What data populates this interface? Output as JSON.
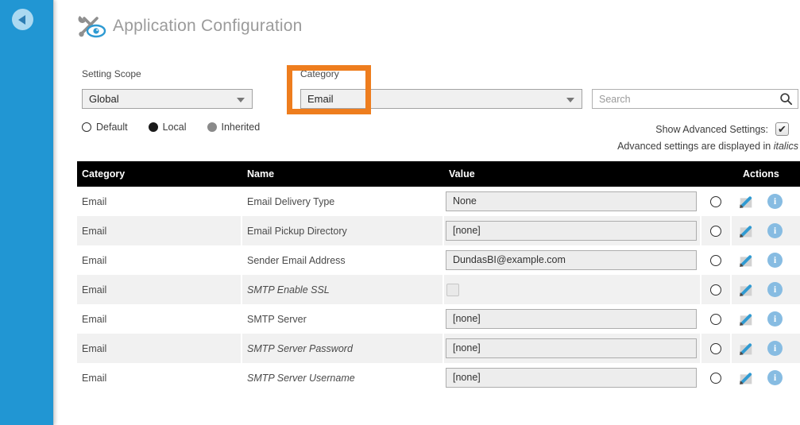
{
  "sidebar": {
    "back_tooltip": "Back"
  },
  "header": {
    "title": "Application Configuration"
  },
  "filters": {
    "setting_scope": {
      "label": "Setting Scope",
      "value": "Global"
    },
    "category": {
      "label": "Category",
      "value": "Email"
    },
    "search": {
      "placeholder": "Search"
    },
    "scope_options": [
      {
        "label": "Default",
        "state": "unchecked"
      },
      {
        "label": "Local",
        "state": "selected-black"
      },
      {
        "label": "Inherited",
        "state": "selected-gray"
      }
    ],
    "advanced_toggle": {
      "label": "Show Advanced Settings:",
      "checked": true,
      "checkmark": "✔"
    },
    "advanced_note": {
      "prefix": "Advanced settings are displayed in ",
      "italic_word": "italics"
    }
  },
  "annotation": {
    "highlight_color": "#ee7d1e",
    "highlighted_control": "category-dropdown"
  },
  "table": {
    "columns": [
      "Category",
      "Name",
      "Value",
      "Actions"
    ],
    "rows": [
      {
        "category": "Email",
        "name": "Email Delivery Type",
        "value": "None",
        "value_type": "text",
        "advanced": false
      },
      {
        "category": "Email",
        "name": "Email Pickup Directory",
        "value": "[none]",
        "value_type": "text",
        "advanced": false
      },
      {
        "category": "Email",
        "name": "Sender Email Address",
        "value": "DundasBI@example.com",
        "value_type": "text",
        "advanced": false
      },
      {
        "category": "Email",
        "name": "SMTP Enable SSL",
        "value": "",
        "value_type": "checkbox",
        "advanced": true
      },
      {
        "category": "Email",
        "name": "SMTP Server",
        "value": "[none]",
        "value_type": "text",
        "advanced": false
      },
      {
        "category": "Email",
        "name": "SMTP Server Password",
        "value": "[none]",
        "value_type": "text",
        "advanced": true
      },
      {
        "category": "Email",
        "name": "SMTP Server Username",
        "value": "[none]",
        "value_type": "text",
        "advanced": true
      }
    ]
  },
  "colors": {
    "sidebar_blue": "#2196d3",
    "accent_blue": "#2e9ad2",
    "info_icon_blue": "#87bce2",
    "table_header_bg": "#000000",
    "row_alt_gray": "#f1f1f1",
    "highlight_orange": "#ee7d1e"
  }
}
